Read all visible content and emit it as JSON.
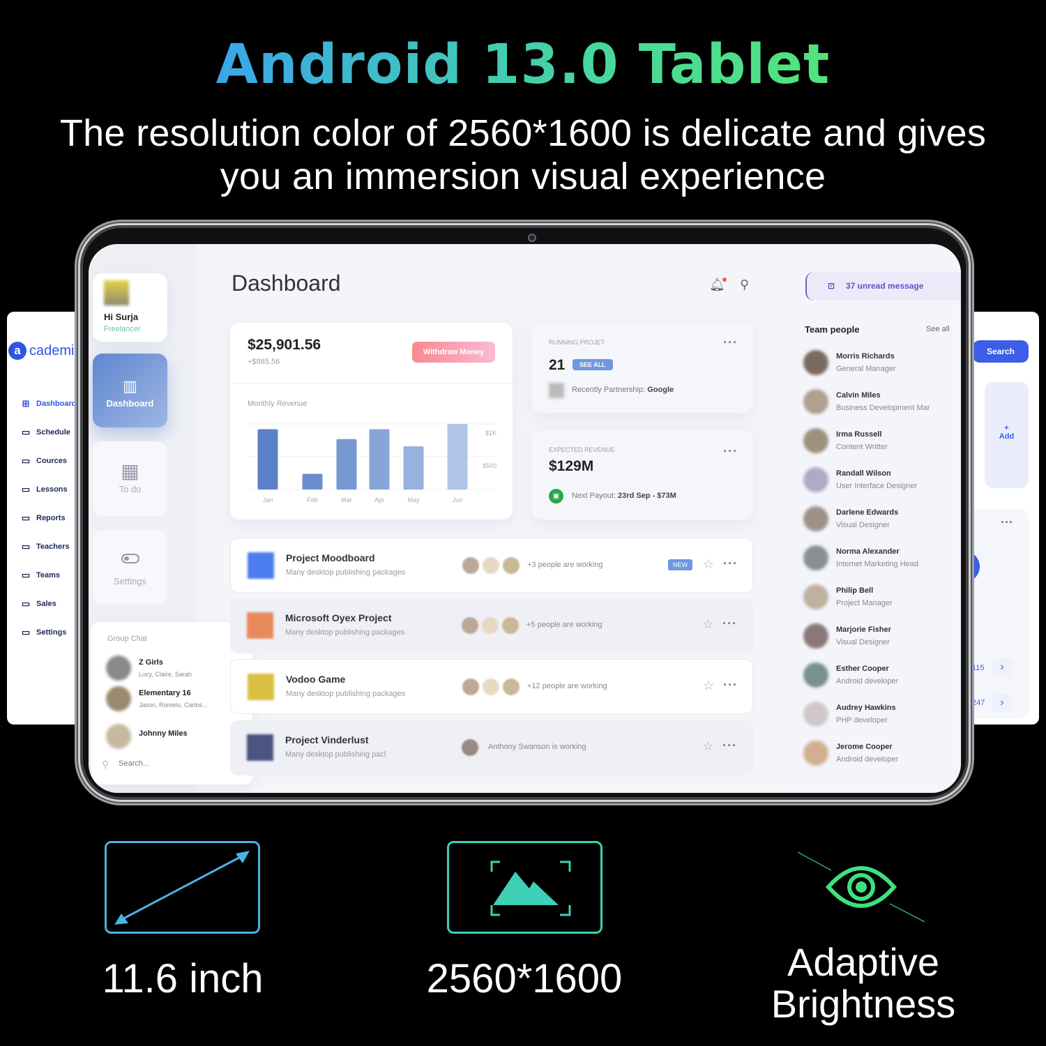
{
  "headline": "Android 13.0 Tablet",
  "subline1": "The resolution color of 2560*1600 is delicate and gives",
  "subline2": "you an immersion visual experience",
  "colors": {
    "headline_start": "#3aa6ea",
    "headline_end": "#52e57a",
    "size_icon": "#4ab3e6",
    "resolution_icon": "#3ed1b6",
    "eye_icon": "#3ee07f",
    "accent_blue": "#3b5de7"
  },
  "left_panel": {
    "logo": "cademi",
    "nav": [
      {
        "label": "Dashboard",
        "icon": "grid-icon",
        "active": true
      },
      {
        "label": "Schedule",
        "icon": "calendar-icon"
      },
      {
        "label": "Cources",
        "icon": "book-icon"
      },
      {
        "label": "Lessons",
        "icon": "book-icon"
      },
      {
        "label": "Reports",
        "icon": "report-icon"
      },
      {
        "label": "Teachers",
        "icon": "user-icon"
      },
      {
        "label": "Teams",
        "icon": "users-icon"
      },
      {
        "label": "Sales",
        "icon": "dollar-icon"
      },
      {
        "label": "Settings",
        "icon": "gear-icon"
      }
    ]
  },
  "right_panel": {
    "search_label": "Search",
    "add_label": "Add",
    "more": "...",
    "values": [
      "115",
      "247"
    ]
  },
  "app": {
    "user": {
      "greeting": "Hi Surja",
      "role": "Freelancer"
    },
    "nav": [
      {
        "label": "Dashboard",
        "icon": "bar-chart-icon",
        "active": true
      },
      {
        "label": "To do",
        "icon": "grid-icon"
      },
      {
        "label": "Settings",
        "icon": "toggle-icon"
      }
    ],
    "group_chat": {
      "title": "Group Chat",
      "chats": [
        {
          "name": "Z Girls",
          "members": "Lucy, Claire, Sarah",
          "online": true
        },
        {
          "name": "Elementary  16",
          "members": "Jason, Romelu, Carlos...",
          "online": false
        },
        {
          "name": "Johnny Miles",
          "members": "",
          "online": true
        }
      ],
      "search_placeholder": "Search..."
    },
    "page_title": "Dashboard",
    "balance": {
      "amount": "$25,901.56",
      "change": "+$985.56",
      "withdraw_label": "Withdraw Money"
    },
    "running": {
      "label": "RUNNING PROJET",
      "count": "21",
      "see_all": "SEE ALL",
      "partner_label": "Recently Partnership:",
      "partner": "Google"
    },
    "expected": {
      "label": "EXPECTED REVENUE",
      "amount": "$129M",
      "payout_label": "Next Payout:",
      "payout": "23rd Sep - $73M"
    },
    "projects": [
      {
        "name": "Project Moodboard",
        "desc": "Many desktop publishing packages",
        "working": "+3 people are working",
        "badge": "NEW",
        "color": "#4d7cf0"
      },
      {
        "name": "Microsoft Oyex Project",
        "desc": "Many desktop publishing packages",
        "working": "+5 people are working",
        "badge": "",
        "color": "#e98a5a"
      },
      {
        "name": "Vodoo Game",
        "desc": "Many desktop publishing packages",
        "working": "+12 people are working",
        "badge": "",
        "color": "#d9c040"
      },
      {
        "name": "Project Vinderlust",
        "desc": "Many desktop publishing pacl",
        "working": "Anthony Swanson is working",
        "badge": "",
        "color": "#4a5580"
      }
    ],
    "unread": "37 unread message",
    "team": {
      "title": "Team people",
      "see_all": "See all",
      "people": [
        {
          "name": "Morris Richards",
          "role": "General Manager"
        },
        {
          "name": "Calvin Miles",
          "role": "Business Development Mar"
        },
        {
          "name": "Irma Russell",
          "role": "Content Writter"
        },
        {
          "name": "Randall Wilson",
          "role": "User Interface Designer"
        },
        {
          "name": "Darlene Edwards",
          "role": "Visual Designer"
        },
        {
          "name": "Norma Alexander",
          "role": "Internet Marketing Head"
        },
        {
          "name": "Philip Bell",
          "role": "Project Manager"
        },
        {
          "name": "Marjorie Fisher",
          "role": "Visual Designer"
        },
        {
          "name": "Esther Cooper",
          "role": "Android developer"
        },
        {
          "name": "Audrey Hawkins",
          "role": "PHP developer"
        },
        {
          "name": "Jerome Cooper",
          "role": "Android developer"
        }
      ]
    }
  },
  "chart_data": {
    "type": "bar",
    "title": "Monthly Revenue",
    "categories": [
      "Jan",
      "Feb",
      "Mar",
      "Apr",
      "May",
      "Jun"
    ],
    "values": [
      920,
      240,
      770,
      920,
      660,
      1000
    ],
    "ylim": [
      0,
      1000
    ],
    "ytick_labels": [
      "$1K",
      "$500"
    ],
    "yticks": [
      1000,
      500
    ],
    "grid": true
  },
  "features": [
    {
      "label": "11.6 inch",
      "icon": "diagonal-arrow-icon"
    },
    {
      "label": "2560*1600",
      "icon": "image-icon"
    },
    {
      "label1": "Adaptive",
      "label2": "Brightness",
      "icon": "eye-icon"
    }
  ]
}
